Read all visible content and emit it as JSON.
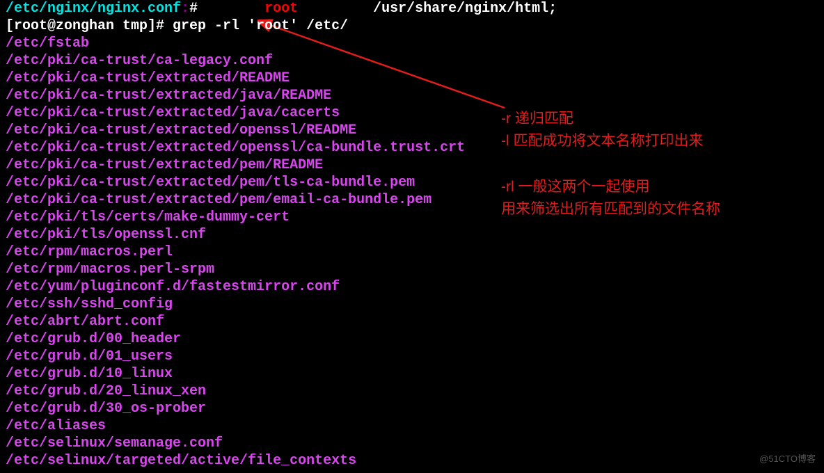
{
  "line1": {
    "path": "/etc/nginx/nginx.conf",
    "colon": ":",
    "hash": "#        ",
    "keyword": "root",
    "rest": "         /usr/share/nginx/html;"
  },
  "prompt": {
    "full": "[root@zonghan tmp]# grep -rl 'root' /etc/"
  },
  "files": [
    "/etc/fstab",
    "/etc/pki/ca-trust/ca-legacy.conf",
    "/etc/pki/ca-trust/extracted/README",
    "/etc/pki/ca-trust/extracted/java/README",
    "/etc/pki/ca-trust/extracted/java/cacerts",
    "/etc/pki/ca-trust/extracted/openssl/README",
    "/etc/pki/ca-trust/extracted/openssl/ca-bundle.trust.crt",
    "/etc/pki/ca-trust/extracted/pem/README",
    "/etc/pki/ca-trust/extracted/pem/tls-ca-bundle.pem",
    "/etc/pki/ca-trust/extracted/pem/email-ca-bundle.pem",
    "/etc/pki/tls/certs/make-dummy-cert",
    "/etc/pki/tls/openssl.cnf",
    "/etc/rpm/macros.perl",
    "/etc/rpm/macros.perl-srpm",
    "/etc/yum/pluginconf.d/fastestmirror.conf",
    "/etc/ssh/sshd_config",
    "/etc/abrt/abrt.conf",
    "/etc/grub.d/00_header",
    "/etc/grub.d/01_users",
    "/etc/grub.d/10_linux",
    "/etc/grub.d/20_linux_xen",
    "/etc/grub.d/30_os-prober",
    "/etc/aliases",
    "/etc/selinux/semanage.conf",
    "/etc/selinux/targeted/active/file_contexts"
  ],
  "annotations": {
    "group1": {
      "line1": "-r 递归匹配",
      "line2": "-l 匹配成功将文本名称打印出来"
    },
    "group2": {
      "line1": "-rl    一般这两个一起使用",
      "line2": "用来筛选出所有匹配到的文件名称"
    }
  },
  "watermark": "@51CTO博客"
}
